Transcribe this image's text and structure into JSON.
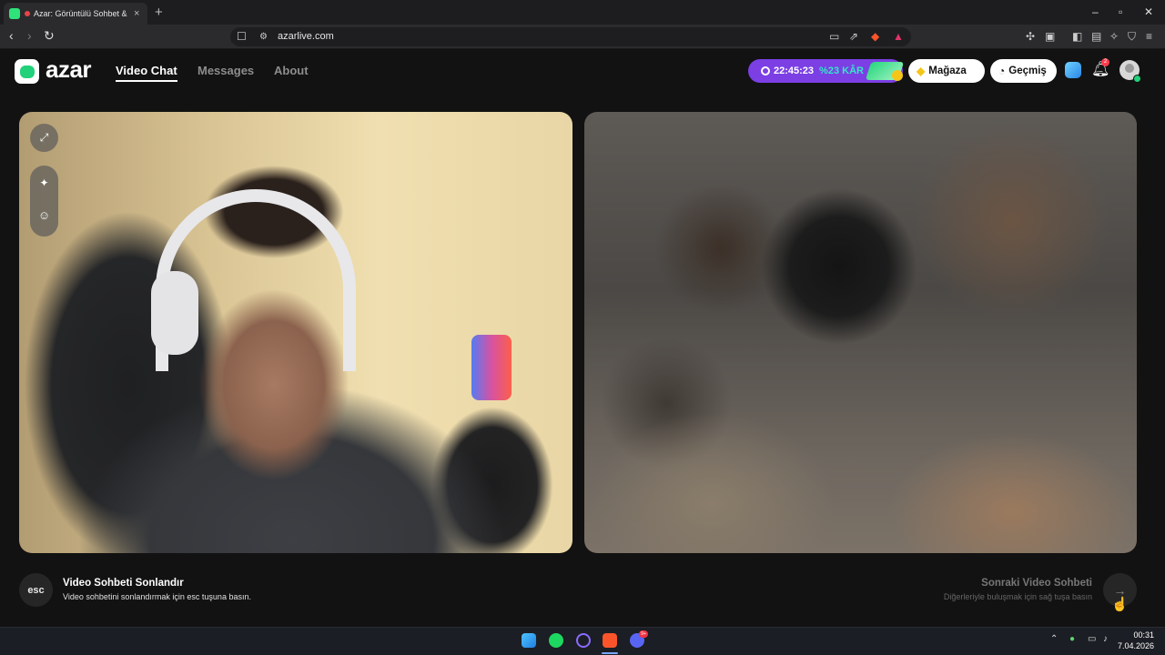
{
  "browser": {
    "tab_title": "Azar: Görüntülü Sohbet & Ye",
    "tab_close": "×",
    "new_tab": "+",
    "url": "azarlive.com",
    "window_controls": [
      "–",
      "▫",
      "✕"
    ],
    "icons": [
      "back-icon",
      "forward-icon",
      "reload-icon",
      "bookmark-icon",
      "site-info-icon",
      "cast-icon",
      "share-icon",
      "brave-shield-icon",
      "brave-rewards-icon",
      "extensions-icon",
      "wallet-icon",
      "leo-icon",
      "vpn-icon",
      "menu-icon"
    ]
  },
  "header": {
    "logo_text": "azar",
    "nav": [
      {
        "label": "Video Chat",
        "active": true
      },
      {
        "label": "Messages",
        "active": false
      },
      {
        "label": "About",
        "active": false
      }
    ],
    "promo": {
      "time": "22:45:23",
      "discount": "%23 KÂR",
      "accent": "#7b3fe4"
    },
    "store_label": "Mağaza",
    "history_label": "Geçmiş",
    "notification_count": "2"
  },
  "video": {
    "controls": [
      "expand-icon",
      "magic-wand-icon",
      "face-filter-icon"
    ]
  },
  "footer": {
    "esc_key": "esc",
    "end_title": "Video Sohbeti Sonlandır",
    "end_subtitle": "Video sohbetini sonlandırmak için esc tuşuna basın.",
    "next_title": "Sonraki Video Sohbeti",
    "next_subtitle": "Diğerleriyle buluşmak için sağ tuşa basın",
    "next_arrow": "→"
  },
  "taskbar": {
    "apps": [
      "windows-start-icon",
      "spotify-icon",
      "search-icon",
      "brave-icon",
      "discord-icon"
    ],
    "discord_badge": "9+",
    "time": "00:31",
    "date": "7.04.2026"
  }
}
